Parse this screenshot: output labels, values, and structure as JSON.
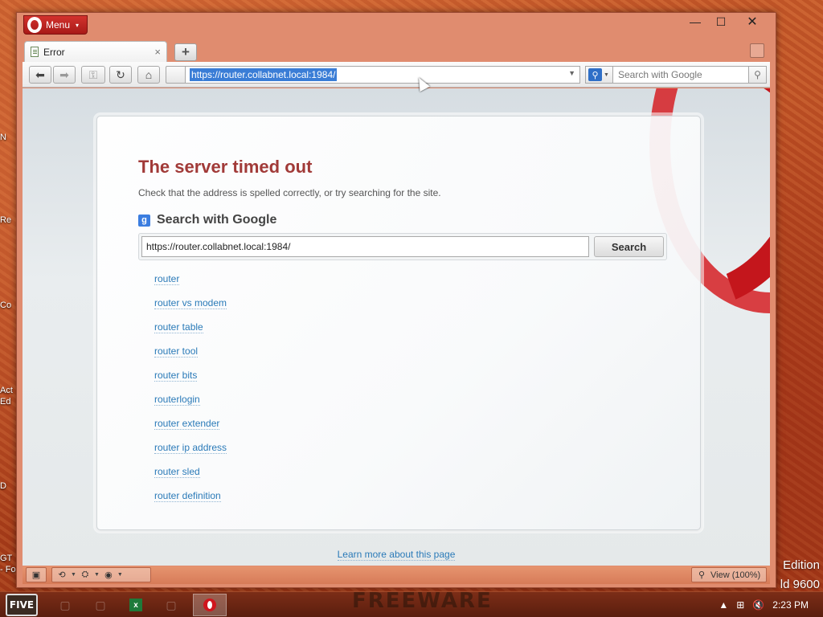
{
  "window": {
    "menu_label": "Menu",
    "controls": {
      "minimize": "—",
      "maximize": "☐",
      "close": "✕"
    }
  },
  "tabs": [
    {
      "title": "Error",
      "close": "×"
    }
  ],
  "new_tab_label": "+",
  "toolbar": {
    "address": "https://router.collabnet.local:1984/",
    "search_placeholder": "Search with Google"
  },
  "page": {
    "title": "The server timed out",
    "description": "Check that the address is spelled correctly, or try searching for the site.",
    "search_heading": "Search with Google",
    "search_value": "https://router.collabnet.local:1984/",
    "search_button": "Search",
    "suggestions": [
      "router",
      "router vs modem",
      "router table",
      "router tool",
      "router bits",
      "routerlogin",
      "router extender",
      "router ip address",
      "router sled",
      "router definition"
    ],
    "learn_more": "Learn more about this page"
  },
  "statusbar": {
    "zoom_label": "View (100%)"
  },
  "desktop": {
    "labels": [
      "N",
      "Re",
      "Co",
      "Act",
      "Ed",
      "D",
      "GT",
      "- Fo"
    ],
    "edition_line1": "Edition",
    "edition_line2": "ld 9600"
  },
  "taskbar": {
    "start_label": "FIVE",
    "watermark": "FREEWARE",
    "clock": "2:23 PM"
  },
  "colors": {
    "error_title": "#a13a38",
    "link": "#2a7ab8",
    "menu_red": "#c62a27",
    "selection": "#3a7dd6"
  }
}
